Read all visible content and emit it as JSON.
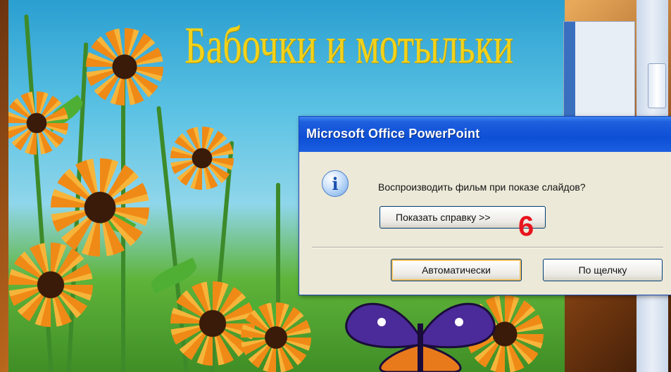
{
  "slide": {
    "title": "Бабочки и мотыльки"
  },
  "dialog": {
    "title": "Microsoft Office PowerPoint",
    "icon": "info-icon",
    "message": "Воспроизводить фильм при показе слайдов?",
    "help_button": "Показать справку >>",
    "auto_button": "Автоматически",
    "click_button": "По щелчку"
  },
  "annotation": {
    "step": "6"
  },
  "colors": {
    "title_text": "#f2d21a",
    "dialog_titlebar": "#0d4fd6",
    "step_marker": "#e8141e"
  }
}
